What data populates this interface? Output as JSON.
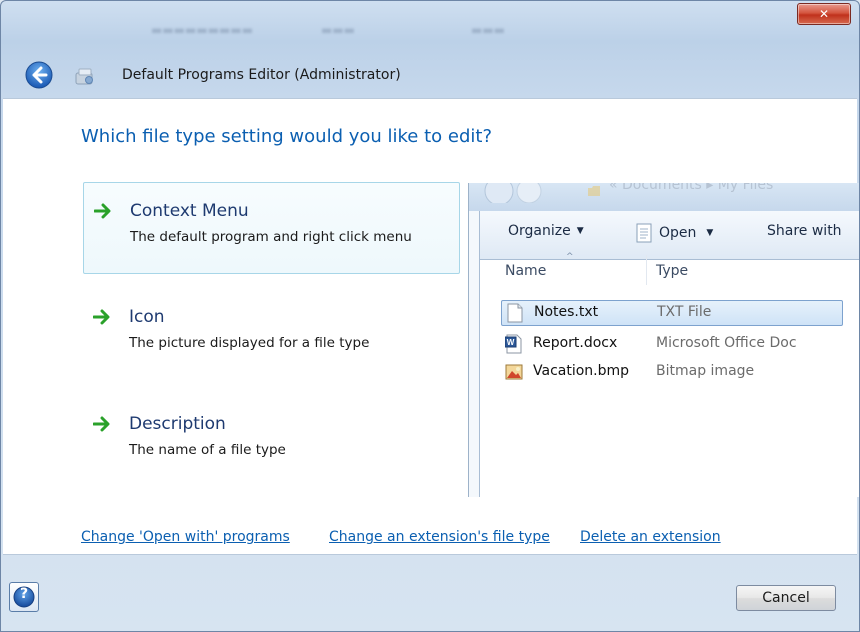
{
  "window": {
    "title": "Default Programs Editor (Administrator)",
    "close_label": "✕"
  },
  "heading": "Which file type setting would you like to edit?",
  "options": [
    {
      "title": "Context Menu",
      "description": "The default program and right click menu",
      "selected": true
    },
    {
      "title": "Icon",
      "description": "The picture displayed for a file type",
      "selected": false
    },
    {
      "title": "Description",
      "description": "The name of a file type",
      "selected": false
    }
  ],
  "preview": {
    "breadcrumb": "« Documents ▸ My Files",
    "toolbar": {
      "organize": "Organize",
      "open": "Open",
      "share": "Share with"
    },
    "columns": {
      "name": "Name",
      "type": "Type"
    },
    "files": [
      {
        "name": "Notes.txt",
        "type": "TXT File",
        "icon": "text-file-icon",
        "selected": true
      },
      {
        "name": "Report.docx",
        "type": "Microsoft Office Doc",
        "icon": "word-document-icon",
        "selected": false
      },
      {
        "name": "Vacation.bmp",
        "type": "Bitmap image",
        "icon": "bitmap-image-icon",
        "selected": false
      }
    ]
  },
  "links": {
    "open_with": "Change 'Open with' programs",
    "extension_type": "Change an extension's file type",
    "delete_extension": "Delete an extension"
  },
  "footer": {
    "help_label": "?",
    "cancel_label": "Cancel"
  },
  "colors": {
    "accent_link": "#0b5fb1",
    "heading": "#0b5fb1",
    "arrow_green": "#2aa12a",
    "close_red": "#c0311c"
  }
}
